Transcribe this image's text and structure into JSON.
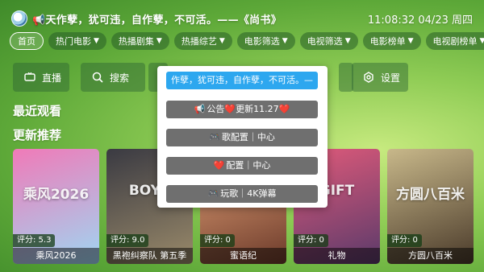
{
  "header": {
    "quote": "📢天作孽，犹可违，自作孽，不可活。——《尚书》",
    "datetime": "11:08:32 04/23 周四"
  },
  "tabs": [
    {
      "label": "首页",
      "filter": false,
      "active": true
    },
    {
      "label": "热门电影",
      "filter": true
    },
    {
      "label": "热播剧集",
      "filter": true
    },
    {
      "label": "热播综艺",
      "filter": true
    },
    {
      "label": "电影筛选",
      "filter": true
    },
    {
      "label": "电视筛选",
      "filter": true
    },
    {
      "label": "电影榜单",
      "filter": true
    },
    {
      "label": "电视剧榜单",
      "filter": true
    }
  ],
  "filter_glyph": "▼",
  "actions": {
    "live": "直播",
    "search": "搜索",
    "settings": "设置"
  },
  "sections": {
    "recent": "最近观看",
    "recommend": "更新推荐"
  },
  "menu": {
    "items": [
      {
        "icon": "",
        "label": "作孽，犹可违，自作孽，不可活。—",
        "highlight": true
      },
      {
        "icon": "📢",
        "label": "公告❤️更新11.27❤️"
      },
      {
        "icon": "🎮",
        "label": "歌配置｜中心"
      },
      {
        "icon": "❤️",
        "label": "配置｜中心"
      },
      {
        "icon": "🎮",
        "label": "玩歌｜4K弹幕"
      }
    ]
  },
  "posters": [
    {
      "rating_label": "评分: 5.3",
      "title": "乘风2026",
      "art_text": "乘风2026",
      "colors": [
        "#f07ab8",
        "#9fd6f2"
      ]
    },
    {
      "rating_label": "评分: 9.0",
      "title": "黑袍纠察队 第五季",
      "art_text": "BOYS",
      "colors": [
        "#3a3a42",
        "#9a8a6a"
      ]
    },
    {
      "rating_label": "评分: 0",
      "title": "蜜语纪",
      "art_text": "",
      "colors": [
        "#e8a57a",
        "#6b3a2a"
      ]
    },
    {
      "rating_label": "评分: 0",
      "title": "礼物",
      "art_text": "GIFT",
      "colors": [
        "#e05a7a",
        "#5a3a6a"
      ]
    },
    {
      "rating_label": "评分: 0",
      "title": "方圆八百米",
      "art_text": "方圆八百米",
      "colors": [
        "#c8b88a",
        "#4a3a2a"
      ]
    }
  ],
  "colors": {
    "accent": "#2da7ef",
    "menu_item": "#6f6f6f",
    "tab_bg": "#2f6a30"
  }
}
